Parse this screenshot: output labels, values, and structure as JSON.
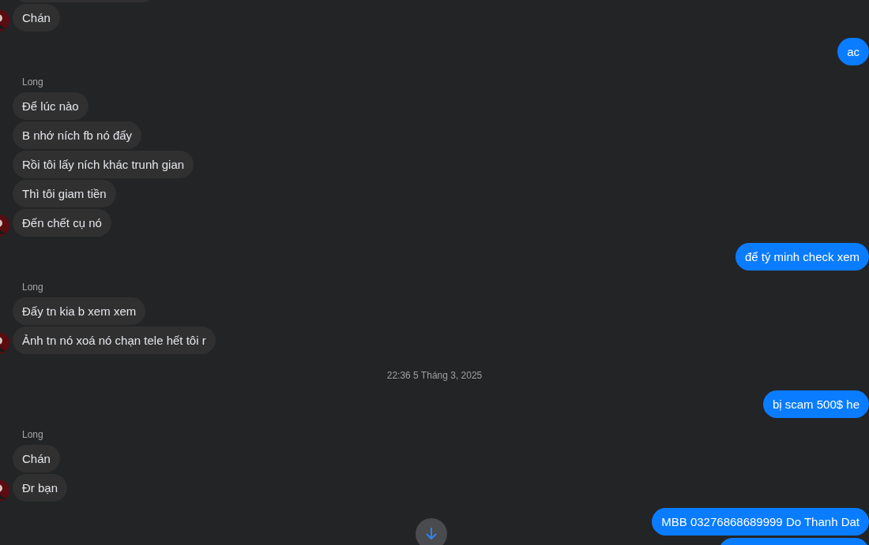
{
  "conversation": [
    {
      "kind": "incoming",
      "messages": [
        {
          "kind": "clipped"
        },
        {
          "kind": "text",
          "text": "Chán"
        }
      ]
    },
    {
      "kind": "outgoing",
      "messages": [
        {
          "kind": "text",
          "text": "ac"
        }
      ]
    },
    {
      "kind": "incoming",
      "sender": "Long",
      "messages": [
        {
          "kind": "text",
          "text": "Để lúc nào"
        },
        {
          "kind": "text",
          "text": "B nhớ ních fb nó đấy"
        },
        {
          "kind": "text",
          "text": "Rồi tôi lấy ních khác trunh gian"
        },
        {
          "kind": "text",
          "text": "Thì tôi giam tiền"
        },
        {
          "kind": "text",
          "text": "Đến chết cụ nó"
        }
      ]
    },
    {
      "kind": "outgoing",
      "messages": [
        {
          "kind": "text",
          "text": "để tý minh check xem"
        }
      ]
    },
    {
      "kind": "incoming",
      "sender": "Long",
      "messages": [
        {
          "kind": "text",
          "text": "Đấy tn kia b xem xem"
        },
        {
          "kind": "text",
          "text": "Ảnh tn nó xoá nó chạn tele hết tôi r"
        }
      ]
    },
    {
      "kind": "timestamp",
      "text": "22:36 5 Tháng 3, 2025"
    },
    {
      "kind": "outgoing",
      "messages": [
        {
          "kind": "text",
          "text": "bị scam 500$ he"
        }
      ]
    },
    {
      "kind": "incoming",
      "sender": "Long",
      "messages": [
        {
          "kind": "text",
          "text": "Chán"
        },
        {
          "kind": "text",
          "text": "Đr bạn"
        }
      ]
    },
    {
      "kind": "outgoing",
      "messages": [
        {
          "kind": "text",
          "text": "MBB 03276868689999 Do Thanh Dat"
        },
        {
          "kind": "clipped"
        }
      ]
    }
  ]
}
